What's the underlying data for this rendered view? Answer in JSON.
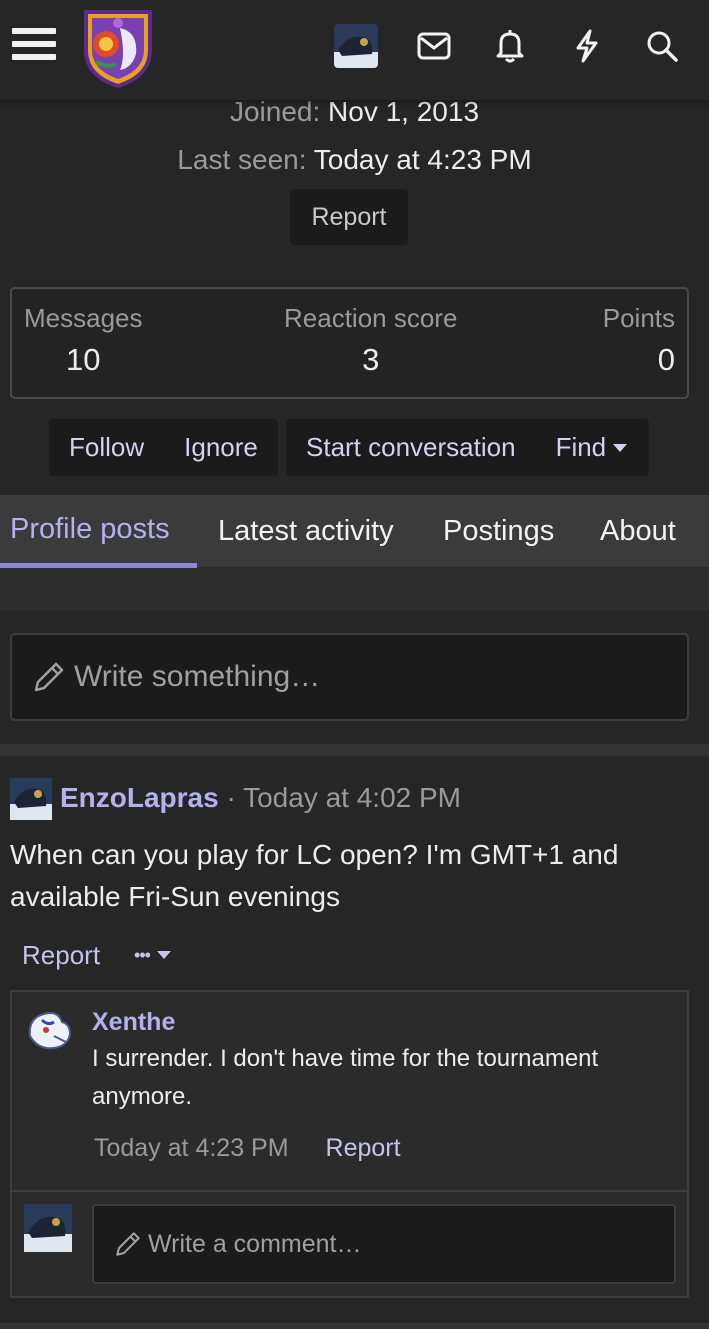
{
  "colors": {
    "background": "#262626",
    "accent": "#8b88d6",
    "link": "#b4b2ec"
  },
  "topbar": {
    "icons": [
      "menu-icon",
      "envelope-icon",
      "bell-icon",
      "bolt-icon",
      "search-icon"
    ]
  },
  "profile": {
    "joined_label": "Joined:",
    "joined_value": "Nov 1, 2013",
    "last_seen_label": "Last seen:",
    "last_seen_value": "Today at 4:23 PM",
    "report_label": "Report"
  },
  "stats": [
    {
      "label": "Messages",
      "value": "10"
    },
    {
      "label": "Reaction score",
      "value": "3"
    },
    {
      "label": "Points",
      "value": "0"
    }
  ],
  "actions": {
    "follow": "Follow",
    "ignore": "Ignore",
    "start_conversation": "Start conversation",
    "find": "Find"
  },
  "tabs": [
    {
      "label": "Profile posts",
      "active": true
    },
    {
      "label": "Latest activity",
      "active": false
    },
    {
      "label": "Postings",
      "active": false
    },
    {
      "label": "About",
      "active": false
    }
  ],
  "composer": {
    "placeholder": "Write something…"
  },
  "post": {
    "user": "EnzoLapras",
    "separator": "·",
    "time": "Today at 4:02 PM",
    "body": "When can you play for LC open? I'm GMT+1 and available Fri-Sun evenings",
    "report_label": "Report",
    "more_label": "•••"
  },
  "comment": {
    "user": "Xenthe",
    "body": "I surrender. I don't have time for the tournament anymore.",
    "time": "Today at 4:23 PM",
    "report_label": "Report"
  },
  "comment_composer": {
    "placeholder": "Write a comment…"
  }
}
